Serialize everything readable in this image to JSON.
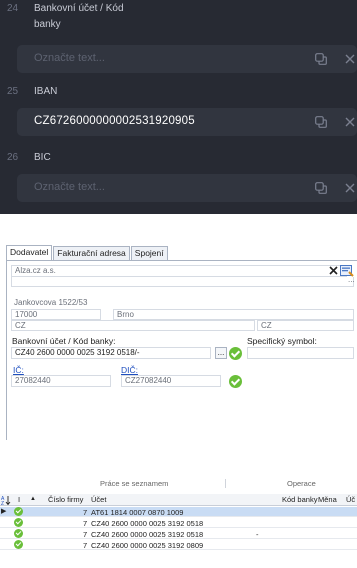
{
  "extraction": {
    "fields": [
      {
        "number": "24",
        "label_line1": "Bankovní účet / Kód",
        "label_line2": "banky",
        "value": "",
        "placeholder": "Označte text..."
      },
      {
        "number": "25",
        "label_line1": "IBAN",
        "label_line2": "",
        "value": "CZ6726000000002531920905",
        "placeholder": ""
      },
      {
        "number": "26",
        "label_line1": "BIC",
        "label_line2": "",
        "value": "",
        "placeholder": "Označte text..."
      }
    ]
  },
  "form": {
    "tabs": [
      "Dodavatel",
      "Fakturační adresa",
      "Spojení"
    ],
    "company": "Alza.cz a.s.",
    "street": "Jankovcova 1522/53",
    "zip": "17000",
    "city": "Brno",
    "country_code": "CZ",
    "country_code2": "CZ",
    "bank_account_label": "Bankovní účet / Kód banky:",
    "bank_account_value": "CZ40 2600 0000 0025 3192 0518/-",
    "specific_symbol_label": "Specifický symbol:",
    "ico_label": "IČ:",
    "ico_value": "27082440",
    "dic_label": "DIČ:",
    "dic_value": "CZ27082440",
    "more_button": "..."
  },
  "grid": {
    "group_headers": [
      "Práce se seznamem",
      "Operace"
    ],
    "columns": [
      "I",
      "Číslo firmy",
      "Účet",
      "Kód banky",
      "Měna",
      "Úč"
    ],
    "rows": [
      {
        "firm": "7",
        "account": "AT61 1814 0007 0870 1009",
        "bank_code": "",
        "selected": true
      },
      {
        "firm": "7",
        "account": "CZ40 2600 0000 0025 3192 0518",
        "bank_code": "",
        "selected": false
      },
      {
        "firm": "7",
        "account": "CZ40 2600 0000 0025 3192 0518",
        "bank_code": "-",
        "selected": false
      },
      {
        "firm": "7",
        "account": "CZ40 2600 0000 0025 3192 0809",
        "bank_code": "",
        "selected": false
      }
    ]
  }
}
